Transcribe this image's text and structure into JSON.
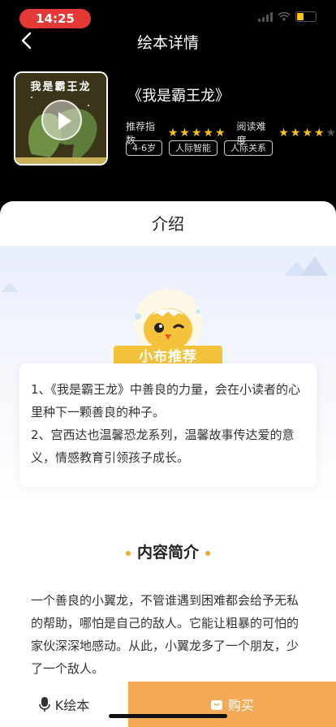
{
  "status_bar": {
    "time": "14:25"
  },
  "nav": {
    "title": "绘本详情"
  },
  "book": {
    "cover_text": "我是霸王龙",
    "title": "《我是霸王龙》",
    "recommend_label": "推荐指数",
    "recommend_stars": 5,
    "difficulty_label": "阅读难度",
    "difficulty_stars": 4,
    "difficulty_max": 5,
    "tags": [
      "4-6岁",
      "人际智能",
      "人际关系"
    ]
  },
  "intro": {
    "header": "介绍",
    "badge": "小布推荐",
    "recommend_lines": [
      "1、《我是霸王龙》中善良的力量，会在小读者的心里种下一颗善良的种子。",
      "2、宫西达也温馨恐龙系列，温馨故事传达爱的意义，情感教育引领孩子成长。"
    ]
  },
  "summary": {
    "title": "内容简介",
    "text": "一个善良的小翼龙，不管谁遇到困难都会给予无私的帮助，哪怕是自己的敌人。它能让粗暴的可怕的家伙深深地感动。从此，小翼龙多了一个朋友，少了一个敌人。"
  },
  "bottom_bar": {
    "k_label": "K绘本",
    "buy_label": "购买"
  },
  "colors": {
    "accent": "#f3a956",
    "star": "#ffc30f",
    "badge": "#f3c33c",
    "time_pill": "#e53935"
  },
  "icons": [
    "back-chevron-icon",
    "play-icon",
    "star-icon",
    "microphone-icon",
    "shopping-bag-icon"
  ]
}
